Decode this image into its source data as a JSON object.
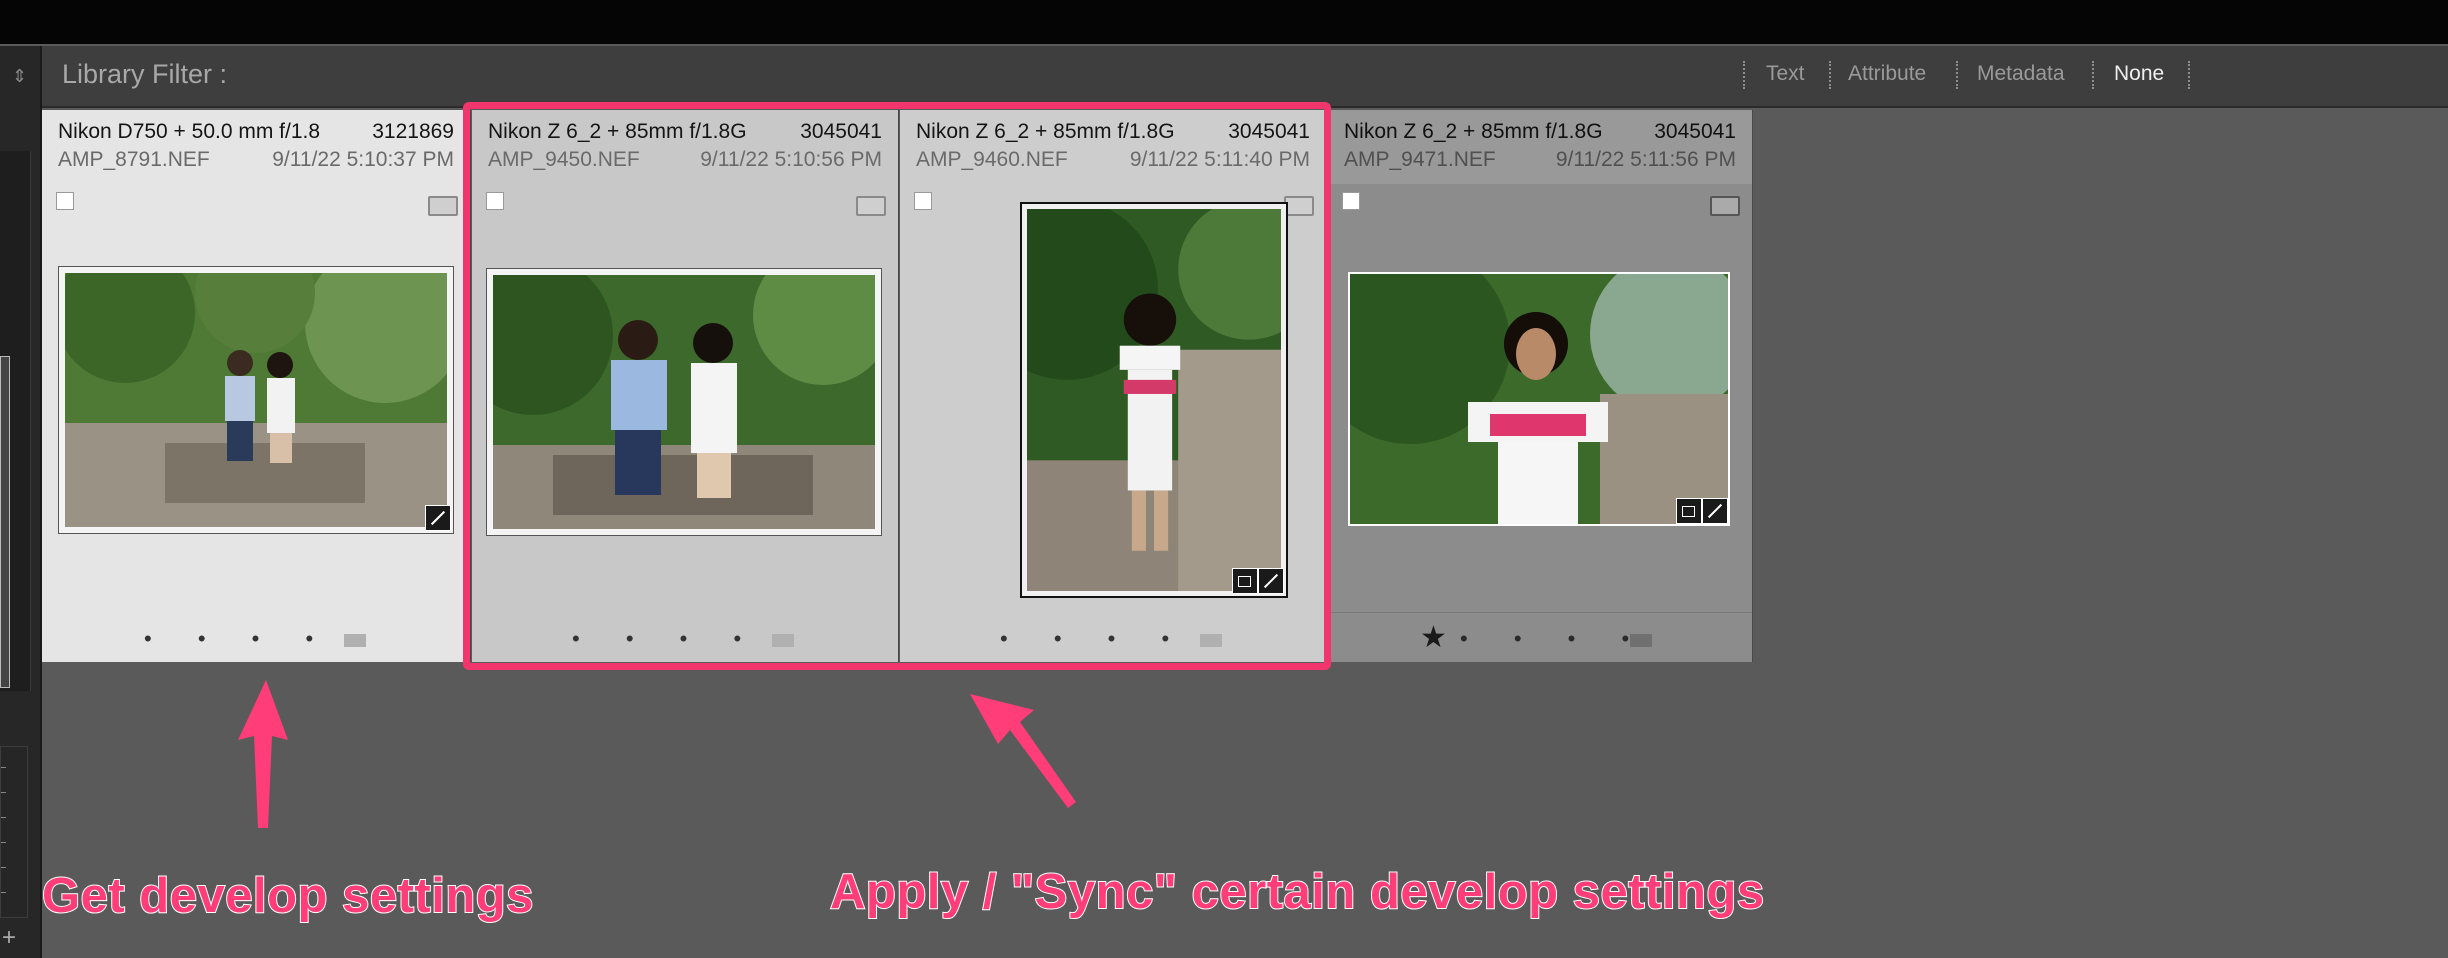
{
  "filter_bar": {
    "title": "Library Filter :",
    "options": [
      "Text",
      "Attribute",
      "Metadata",
      "None"
    ],
    "active": "None"
  },
  "cells": [
    {
      "camera": "Nikon D750 + 50.0 mm f/1.8",
      "number": "3121869",
      "file": "AMP_8791.NEF",
      "date": "9/11/22 5:10:37 PM",
      "dots": "• • • • •",
      "stars": 0,
      "orientation": "landscape"
    },
    {
      "camera": "Nikon Z 6_2 + 85mm f/1.8G",
      "number": "3045041",
      "file": "AMP_9450.NEF",
      "date": "9/11/22 5:10:56 PM",
      "dots": "• • • • •",
      "stars": 0,
      "orientation": "landscape"
    },
    {
      "camera": "Nikon Z 6_2 + 85mm f/1.8G",
      "number": "3045041",
      "file": "AMP_9460.NEF",
      "date": "9/11/22 5:11:40 PM",
      "dots": "• • • • •",
      "stars": 0,
      "orientation": "portrait"
    },
    {
      "camera": "Nikon Z 6_2 + 85mm f/1.8G",
      "number": "3045041",
      "file": "AMP_9471.NEF",
      "date": "9/11/22 5:11:56 PM",
      "dots": "• • • •",
      "stars": 1,
      "star_glyph": "★",
      "orientation": "landscape"
    }
  ],
  "annotations": {
    "left": "Get develop settings",
    "right": "Apply / \"Sync\" certain develop settings"
  },
  "colors": {
    "highlight": "#f2366d",
    "annotation_text": "#ff3d78",
    "cell_light": "#e5e5e5",
    "cell_selected": "#c8c8c8",
    "cell_dim": "#8c8c8c"
  }
}
